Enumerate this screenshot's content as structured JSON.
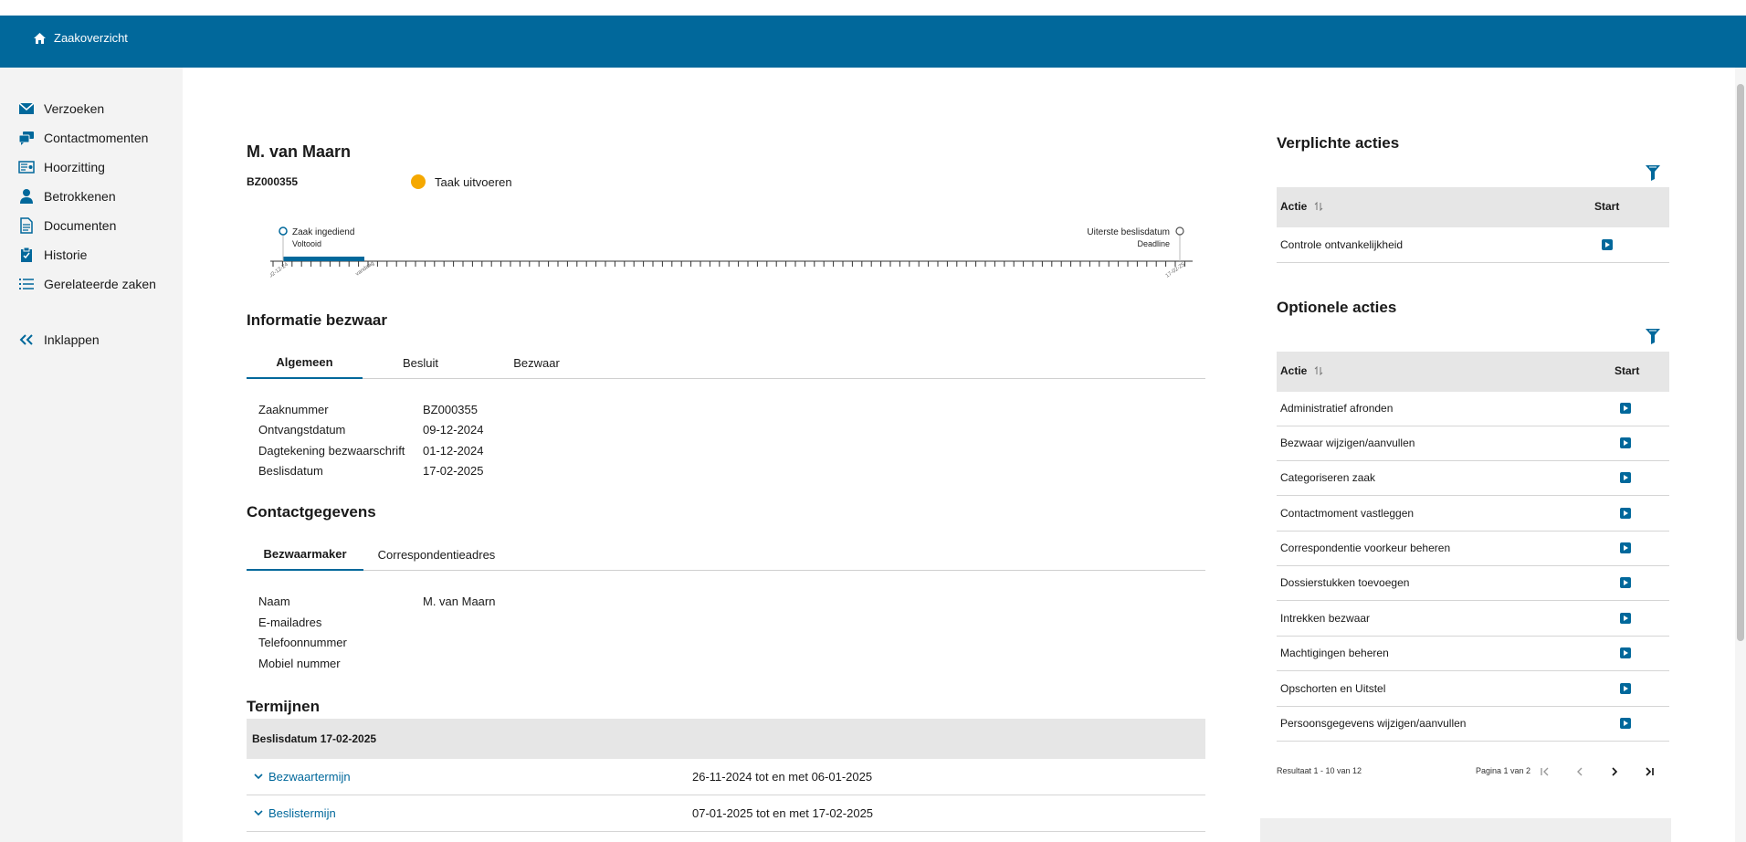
{
  "header": {
    "home_label": "Zaakoverzicht"
  },
  "sidebar": {
    "items": [
      {
        "label": "Verzoeken"
      },
      {
        "label": "Contactmomenten"
      },
      {
        "label": "Hoorzitting"
      },
      {
        "label": "Betrokkenen"
      },
      {
        "label": "Documenten"
      },
      {
        "label": "Historie"
      },
      {
        "label": "Gerelateerde zaken"
      }
    ],
    "collapse_label": "Inklappen"
  },
  "case": {
    "name": "M. van Maarn",
    "number": "BZ000355",
    "status_text": "Taak uitvoeren",
    "status_color": "#f5a800"
  },
  "timeline": {
    "start_title": "Zaak ingediend",
    "start_sub": "Voltooid",
    "end_title": "Uiterste beslisdatum",
    "end_sub": "Deadline",
    "tick_start": "02-12-24",
    "tick_mid": "vandaag",
    "tick_end": "17-02-25"
  },
  "info": {
    "title": "Informatie bezwaar",
    "tabs": [
      "Algemeen",
      "Besluit",
      "Bezwaar"
    ],
    "fields": [
      {
        "label": "Zaaknummer",
        "value": "BZ000355"
      },
      {
        "label": "Ontvangstdatum",
        "value": "09-12-2024"
      },
      {
        "label": "Dagtekening bezwaarschrift",
        "value": "01-12-2024"
      },
      {
        "label": "Beslisdatum",
        "value": "17-02-2025"
      }
    ]
  },
  "contact": {
    "title": "Contactgegevens",
    "tabs": [
      "Bezwaarmaker",
      "Correspondentieadres"
    ],
    "fields": [
      {
        "label": "Naam",
        "value": "M. van Maarn"
      },
      {
        "label": "E-mailadres",
        "value": ""
      },
      {
        "label": "Telefoonnummer",
        "value": ""
      },
      {
        "label": "Mobiel nummer",
        "value": ""
      }
    ]
  },
  "termijnen": {
    "title": "Termijnen",
    "header": "Beslisdatum 17-02-2025",
    "rows": [
      {
        "label": "Bezwaartermijn",
        "period": "26-11-2024 tot en met 06-01-2025"
      },
      {
        "label": "Beslistermijn",
        "period": "07-01-2025 tot en met 17-02-2025"
      }
    ]
  },
  "verplicht": {
    "title": "Verplichte acties",
    "col_actie": "Actie",
    "col_start": "Start",
    "rows": [
      "Controle ontvankelijkheid"
    ]
  },
  "optioneel": {
    "title": "Optionele acties",
    "col_actie": "Actie",
    "col_start": "Start",
    "rows": [
      "Administratief afronden",
      "Bezwaar wijzigen/aanvullen",
      "Categoriseren zaak",
      "Contactmoment vastleggen",
      "Correspondentie voorkeur beheren",
      "Dossierstukken toevoegen",
      "Intrekken bezwaar",
      "Machtigingen beheren",
      "Opschorten en Uitstel",
      "Persoonsgegevens wijzigen/aanvullen"
    ],
    "result_text": "Resultaat 1 - 10 van 12",
    "page_text": "Pagina 1 van 2"
  }
}
